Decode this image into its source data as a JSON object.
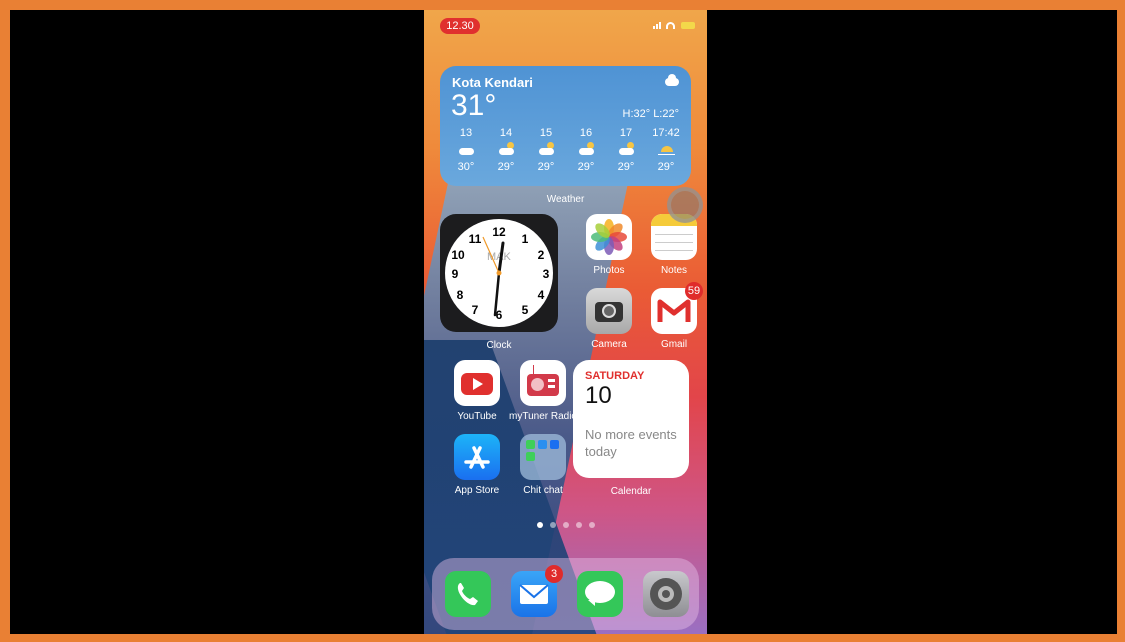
{
  "status_bar": {
    "time": "12.30"
  },
  "weather": {
    "city": "Kota Kendari",
    "temp": "31°",
    "high_low": "H:32° L:22°",
    "forecast": [
      {
        "time": "13",
        "icon": "cloud-icon",
        "temp": "30°"
      },
      {
        "time": "14",
        "icon": "partly-sunny-icon",
        "temp": "29°"
      },
      {
        "time": "15",
        "icon": "partly-sunny-icon",
        "temp": "29°"
      },
      {
        "time": "16",
        "icon": "partly-sunny-icon",
        "temp": "29°"
      },
      {
        "time": "17",
        "icon": "partly-sunny-icon",
        "temp": "29°"
      },
      {
        "time": "17:42",
        "icon": "sunset-icon",
        "temp": "29°"
      }
    ],
    "label": "Weather"
  },
  "clock": {
    "label": "Clock",
    "city": "MAK"
  },
  "apps": {
    "photos": "Photos",
    "notes": "Notes",
    "camera": "Camera",
    "gmail": "Gmail",
    "gmail_badge": "59",
    "youtube": "YouTube",
    "mytuner": "myTuner Radio",
    "appstore": "App Store",
    "chitchat": "Chit chat"
  },
  "calendar": {
    "day": "SATURDAY",
    "date": "10",
    "events": "No more events today",
    "label": "Calendar"
  },
  "dock": {
    "mail_badge": "3"
  },
  "colors": {
    "accent_frame": "#e98034",
    "badge": "#e02b2b"
  }
}
